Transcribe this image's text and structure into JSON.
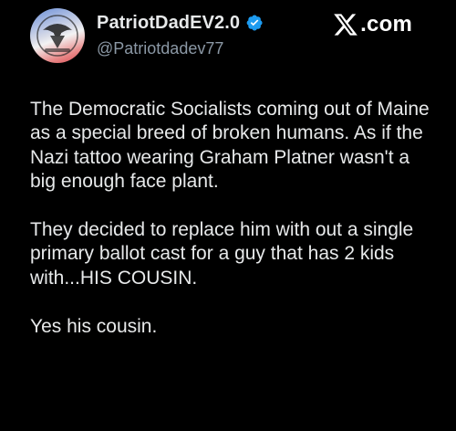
{
  "author": {
    "display_name": "PatriotDadEV2.0",
    "handle": "@Patriotdadev77",
    "avatar_label": "PATRIOTDADEV2"
  },
  "brand": {
    "name": ".com"
  },
  "icons": {
    "verified": "verified-badge-icon",
    "x_logo": "x-logo-icon"
  },
  "colors": {
    "verified": "#1d9bf0",
    "handle": "#8b98a5",
    "text": "#e7e9ea",
    "background": "#000000"
  },
  "post": {
    "paragraphs": [
      "The Democratic Socialists coming out of Maine as a special breed of broken humans. As if the Nazi tattoo wearing Graham Platner wasn't a big enough face plant.",
      "They decided to replace him with out a single primary ballot cast for a guy that has 2 kids with...HIS COUSIN.",
      "Yes his cousin."
    ]
  }
}
